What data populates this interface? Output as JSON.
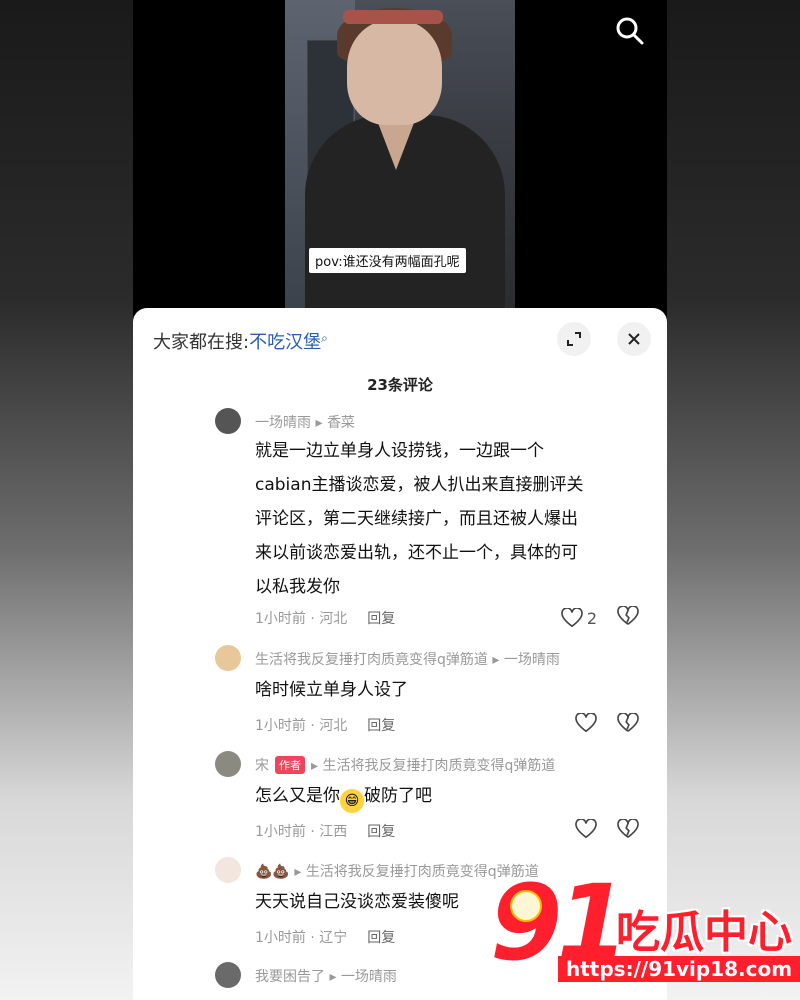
{
  "video": {
    "caption": "pov:谁还没有两幅面孔呢"
  },
  "sheet": {
    "search_prefix": "大家都在搜:",
    "search_term": "不吃汉堡",
    "comment_count": "23条评论"
  },
  "comments": [
    {
      "user": "一场晴雨",
      "reply_to": "香菜",
      "text": [
        "就是一边立单身人设捞钱，一边跟一个",
        "cabian主播谈恋爱，被人扒出来直接删评关",
        "评论区，第二天继续接广，而且还被人爆出",
        "来以前谈恋爱出轨，还不止一个，具体的可",
        "以私我发你"
      ],
      "time": "1小时前 · 河北",
      "reply": "回复",
      "likes": "2"
    },
    {
      "user": "生活将我反复捶打肉质竟变得q弹筋道",
      "reply_to": "一场晴雨",
      "text": [
        "啥时候立单身人设了"
      ],
      "time": "1小时前 · 河北",
      "reply": "回复",
      "likes": ""
    },
    {
      "user": "宋",
      "badge": "作者",
      "reply_to": "生活将我反复捶打肉质竟变得q弹筋道",
      "text_before": "怎么又是你",
      "text_after": "破防了吧",
      "time": "1小时前 · 江西",
      "reply": "回复",
      "likes": ""
    },
    {
      "user": "💩💩",
      "reply_to": "生活将我反复捶打肉质竟变得q弹筋道",
      "text": [
        "天天说自己没谈恋爱装傻呢"
      ],
      "time": "1小时前 · 辽宁",
      "reply": "回复",
      "likes": ""
    },
    {
      "user": "我要困告了",
      "reply_to": "一场晴雨"
    }
  ],
  "watermark": {
    "number": "91",
    "name": "吃瓜中心",
    "url": "https://91vip18.com"
  },
  "colors": {
    "accent_link": "#2a5db0",
    "badge": "#f0445a",
    "watermark": "#ff1f2d"
  }
}
